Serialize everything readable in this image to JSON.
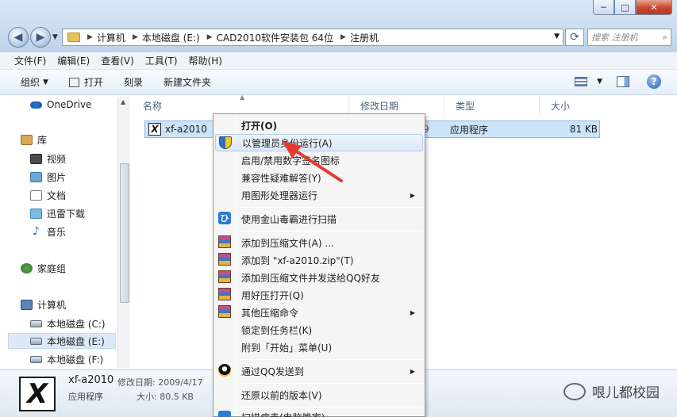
{
  "window": {
    "buttons": {
      "minimize": "─",
      "maximize": "□",
      "close": "✕"
    }
  },
  "nav": {
    "back": "◀",
    "forward": "▶"
  },
  "address": {
    "crumbs": [
      "计算机",
      "本地磁盘 (E:)",
      "CAD2010软件安装包 64位",
      "注册机"
    ]
  },
  "search": {
    "placeholder": "搜索 注册机"
  },
  "menubar": [
    "文件(F)",
    "编辑(E)",
    "查看(V)",
    "工具(T)",
    "帮助(H)"
  ],
  "toolbar": {
    "organize": "组织",
    "open": "打开",
    "burn": "刻录",
    "new_folder": "新建文件夹"
  },
  "navpane": {
    "items": [
      {
        "label": "OneDrive",
        "icon": "cloud-icon"
      },
      {
        "label": "库",
        "icon": "library-icon"
      },
      {
        "label": "视频",
        "icon": "video-icon"
      },
      {
        "label": "图片",
        "icon": "pictures-icon"
      },
      {
        "label": "文档",
        "icon": "documents-icon"
      },
      {
        "label": "迅雷下载",
        "icon": "download-icon"
      },
      {
        "label": "音乐",
        "icon": "music-icon"
      },
      {
        "label": "家庭组",
        "icon": "homegroup-icon"
      },
      {
        "label": "计算机",
        "icon": "computer-icon"
      },
      {
        "label": "本地磁盘 (C:)",
        "icon": "drive-icon"
      },
      {
        "label": "本地磁盘 (E:)",
        "icon": "drive-icon"
      },
      {
        "label": "本地磁盘 (F:)",
        "icon": "drive-icon"
      }
    ]
  },
  "columns": {
    "name": "名称",
    "modified": "修改日期",
    "type": "类型",
    "size": "大小"
  },
  "file": {
    "name": "xf-a2010",
    "modified_partial": "9",
    "type": "应用程序",
    "size": "81 KB"
  },
  "context_menu": {
    "items": [
      {
        "label": "打开(O)"
      },
      {
        "label": "以管理员身份运行(A)"
      },
      {
        "label": "启用/禁用数字签名图标"
      },
      {
        "label": "兼容性疑难解答(Y)"
      },
      {
        "label": "用图形处理器运行"
      },
      {
        "label": "使用金山毒霸进行扫描"
      },
      {
        "label": "添加到压缩文件(A) ..."
      },
      {
        "label": "添加到 \"xf-a2010.zip\"(T)"
      },
      {
        "label": "添加到压缩文件并发送给QQ好友"
      },
      {
        "label": "用好压打开(Q)"
      },
      {
        "label": "其他压缩命令"
      },
      {
        "label": "锁定到任务栏(K)"
      },
      {
        "label": "附到「开始」菜单(U)"
      },
      {
        "label": "通过QQ发送到"
      },
      {
        "label": "还原以前的版本(V)"
      },
      {
        "label": "扫描病毒(电脑管家)"
      }
    ]
  },
  "details": {
    "name": "xf-a2010",
    "modified_label": "修改日期: 2009/4/17",
    "type": "应用程序",
    "size_label": "大小: 80.5 KB"
  },
  "watermark": {
    "text": "哏儿都校园"
  },
  "colors": {
    "selection": "#cce4fa",
    "accent": "#2a65b4",
    "arrow": "#e53a2f"
  }
}
